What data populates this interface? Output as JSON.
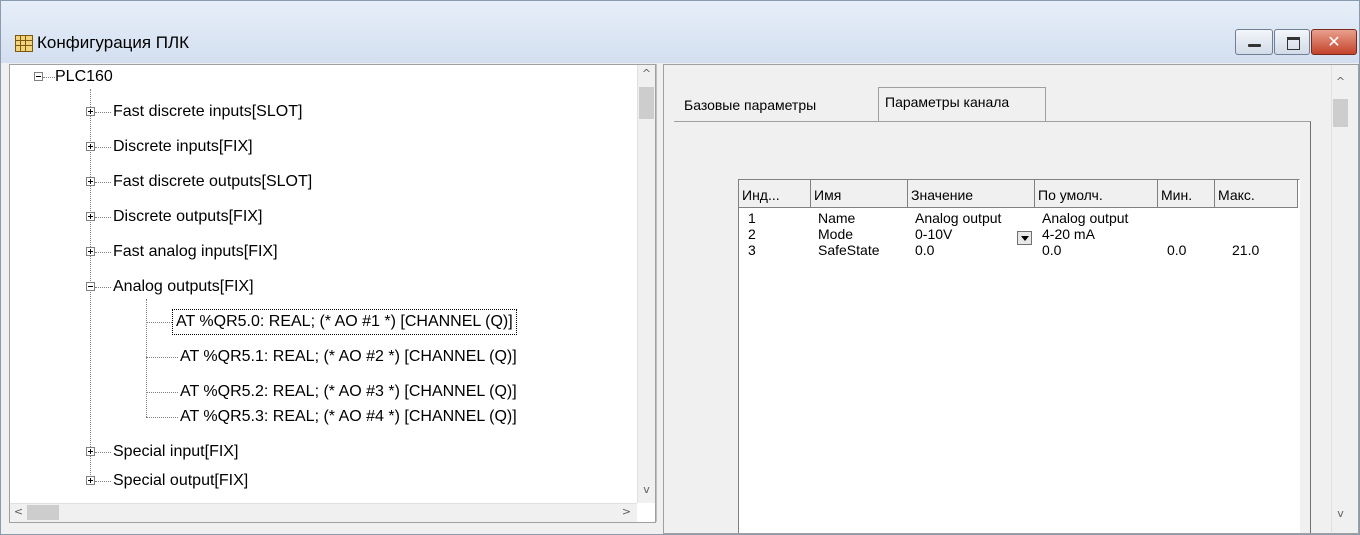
{
  "window": {
    "title": "Конфигурация ПЛК",
    "close_glyph": "✕"
  },
  "tree": {
    "root": "PLC160",
    "items": [
      {
        "label": "Fast discrete inputs[SLOT]",
        "state": "collapsed"
      },
      {
        "label": "Discrete inputs[FIX]",
        "state": "collapsed"
      },
      {
        "label": "Fast discrete outputs[SLOT]",
        "state": "collapsed"
      },
      {
        "label": "Discrete outputs[FIX]",
        "state": "collapsed"
      },
      {
        "label": "Fast analog inputs[FIX]",
        "state": "collapsed"
      },
      {
        "label": "Analog outputs[FIX]",
        "state": "expanded"
      },
      {
        "label": "Special input[FIX]",
        "state": "collapsed"
      },
      {
        "label": "Special output[FIX]",
        "state": "collapsed"
      }
    ],
    "channels": [
      "AT %QR5.0: REAL; (* AO #1 *) [CHANNEL (Q)]",
      "AT %QR5.1: REAL; (* AO #2 *) [CHANNEL (Q)]",
      "AT %QR5.2: REAL; (* AO #3 *) [CHANNEL (Q)]",
      "AT %QR5.3: REAL; (* AO #4 *) [CHANNEL (Q)]"
    ],
    "selected_channel": "AT %QR5.0: REAL; (* AO #1 *) [CHANNEL (Q)]"
  },
  "scroll": {
    "up": "^",
    "down": "v",
    "left": "<",
    "right": ">"
  },
  "tabs": [
    {
      "label": "Базовые параметры",
      "active": false
    },
    {
      "label": "Параметры канала",
      "active": true
    }
  ],
  "params_table": {
    "columns": [
      "Инд...",
      "Имя",
      "Значение",
      "По умолч.",
      "Мин.",
      "Макс."
    ],
    "rows": [
      {
        "index": "1",
        "name": "Name",
        "value": "Analog output",
        "default": "Analog output",
        "min": "",
        "max": ""
      },
      {
        "index": "2",
        "name": "Mode",
        "value": "0-10V",
        "default": "4-20 mA",
        "min": "",
        "max": ""
      },
      {
        "index": "3",
        "name": "SafeState",
        "value": "0.0",
        "default": "0.0",
        "min": "0.0",
        "max": "21.0"
      }
    ]
  }
}
